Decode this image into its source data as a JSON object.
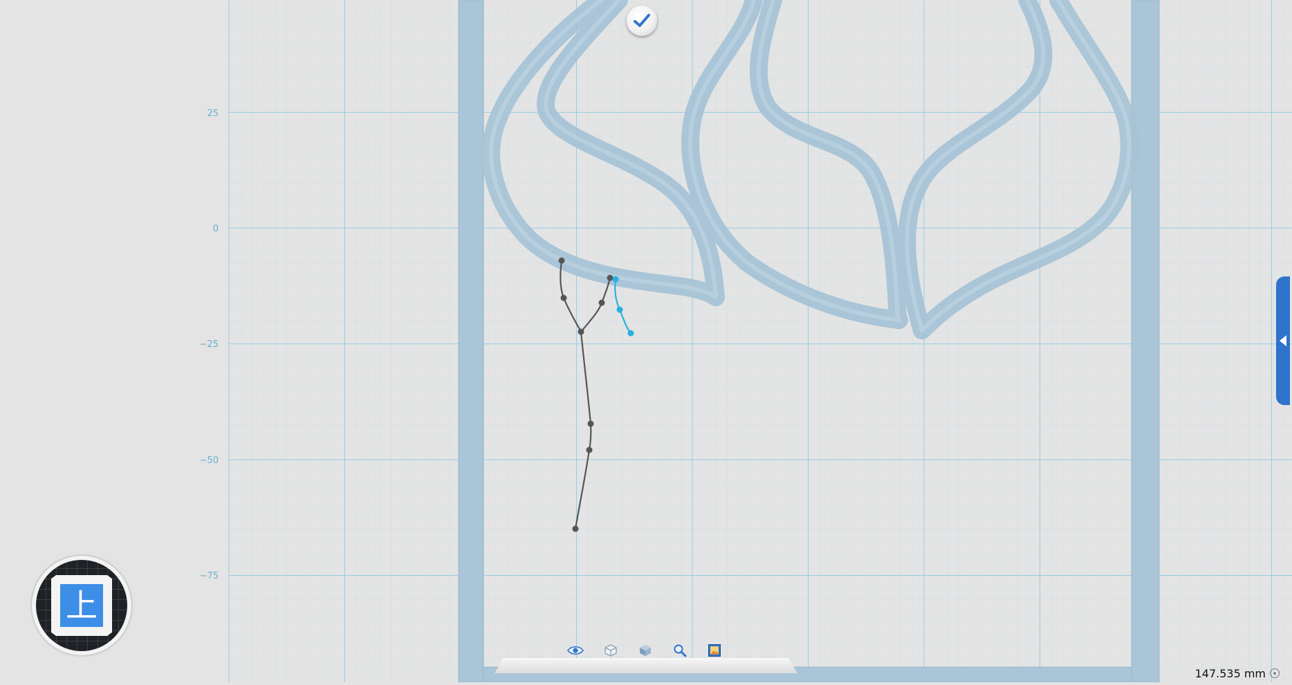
{
  "viewport": {
    "axis_labels": [
      "25",
      "0",
      "−25",
      "−50",
      "−75"
    ]
  },
  "view_cube": {
    "face_label": "上"
  },
  "toolbar": {
    "buttons": [
      {
        "icon": "eye-icon"
      },
      {
        "icon": "wireframe-cube-icon"
      },
      {
        "icon": "solid-cube-icon"
      },
      {
        "icon": "magnifier-icon"
      },
      {
        "icon": "image-render-icon"
      }
    ]
  },
  "status": {
    "measurement": "147.535 mm"
  },
  "colors": {
    "background": "#e4e4e4",
    "grid_major": "#8fcce6",
    "grid_minor": "#c2dde8",
    "model": "#a7c4d6",
    "accent": "#3d8ee6",
    "sketch": "#555555",
    "selection": "#29b0e0"
  }
}
